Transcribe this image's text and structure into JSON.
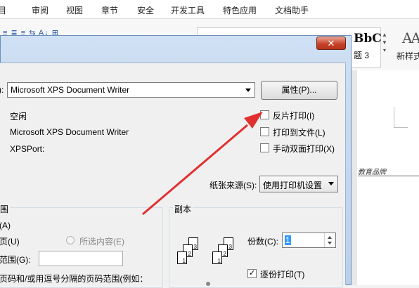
{
  "menubar": {
    "items": [
      "审阅",
      "视图",
      "章节",
      "安全",
      "开发工具",
      "特色应用",
      "文档助手"
    ],
    "partial_left": "目"
  },
  "ribbon": {
    "style_sample": "AaBbC",
    "style_sample_partial": "BbC",
    "style_name_partial": "题 3",
    "new_style_label": "新样式"
  },
  "dialog": {
    "close_symbol": "✕",
    "printer": {
      "name_label_partial": "):",
      "selected": "Microsoft XPS Document Writer",
      "properties_button": "属性(P)...",
      "status": "空闲",
      "type": "Microsoft XPS Document Writer",
      "where": "XPSPort:"
    },
    "options": [
      {
        "label": "反片打印(I)",
        "checked": false
      },
      {
        "label": "打印到文件(L)",
        "checked": false
      },
      {
        "label": "手动双面打印(X)",
        "checked": false
      }
    ],
    "paper_source": {
      "label": "纸张来源(S):",
      "value": "使用打印机设置"
    },
    "page_range": {
      "title_partial": "围",
      "all_partial": "(A)",
      "current_partial": "页(U)",
      "selection": "所选内容(E)",
      "range_partial": "范围(G):",
      "hint_partial": "页码和/或用逗号分隔的页码范围(例如："
    },
    "copies": {
      "title": "副本",
      "count_label": "份数(C):",
      "count_value": "1",
      "collate_label": "逐份打印(T)",
      "collate_checked": true
    }
  },
  "document": {
    "header_text": "教育品牌"
  },
  "colors": {
    "arrow": "#e03030",
    "close_button": "#c7432b",
    "selection": "#3399ff"
  }
}
